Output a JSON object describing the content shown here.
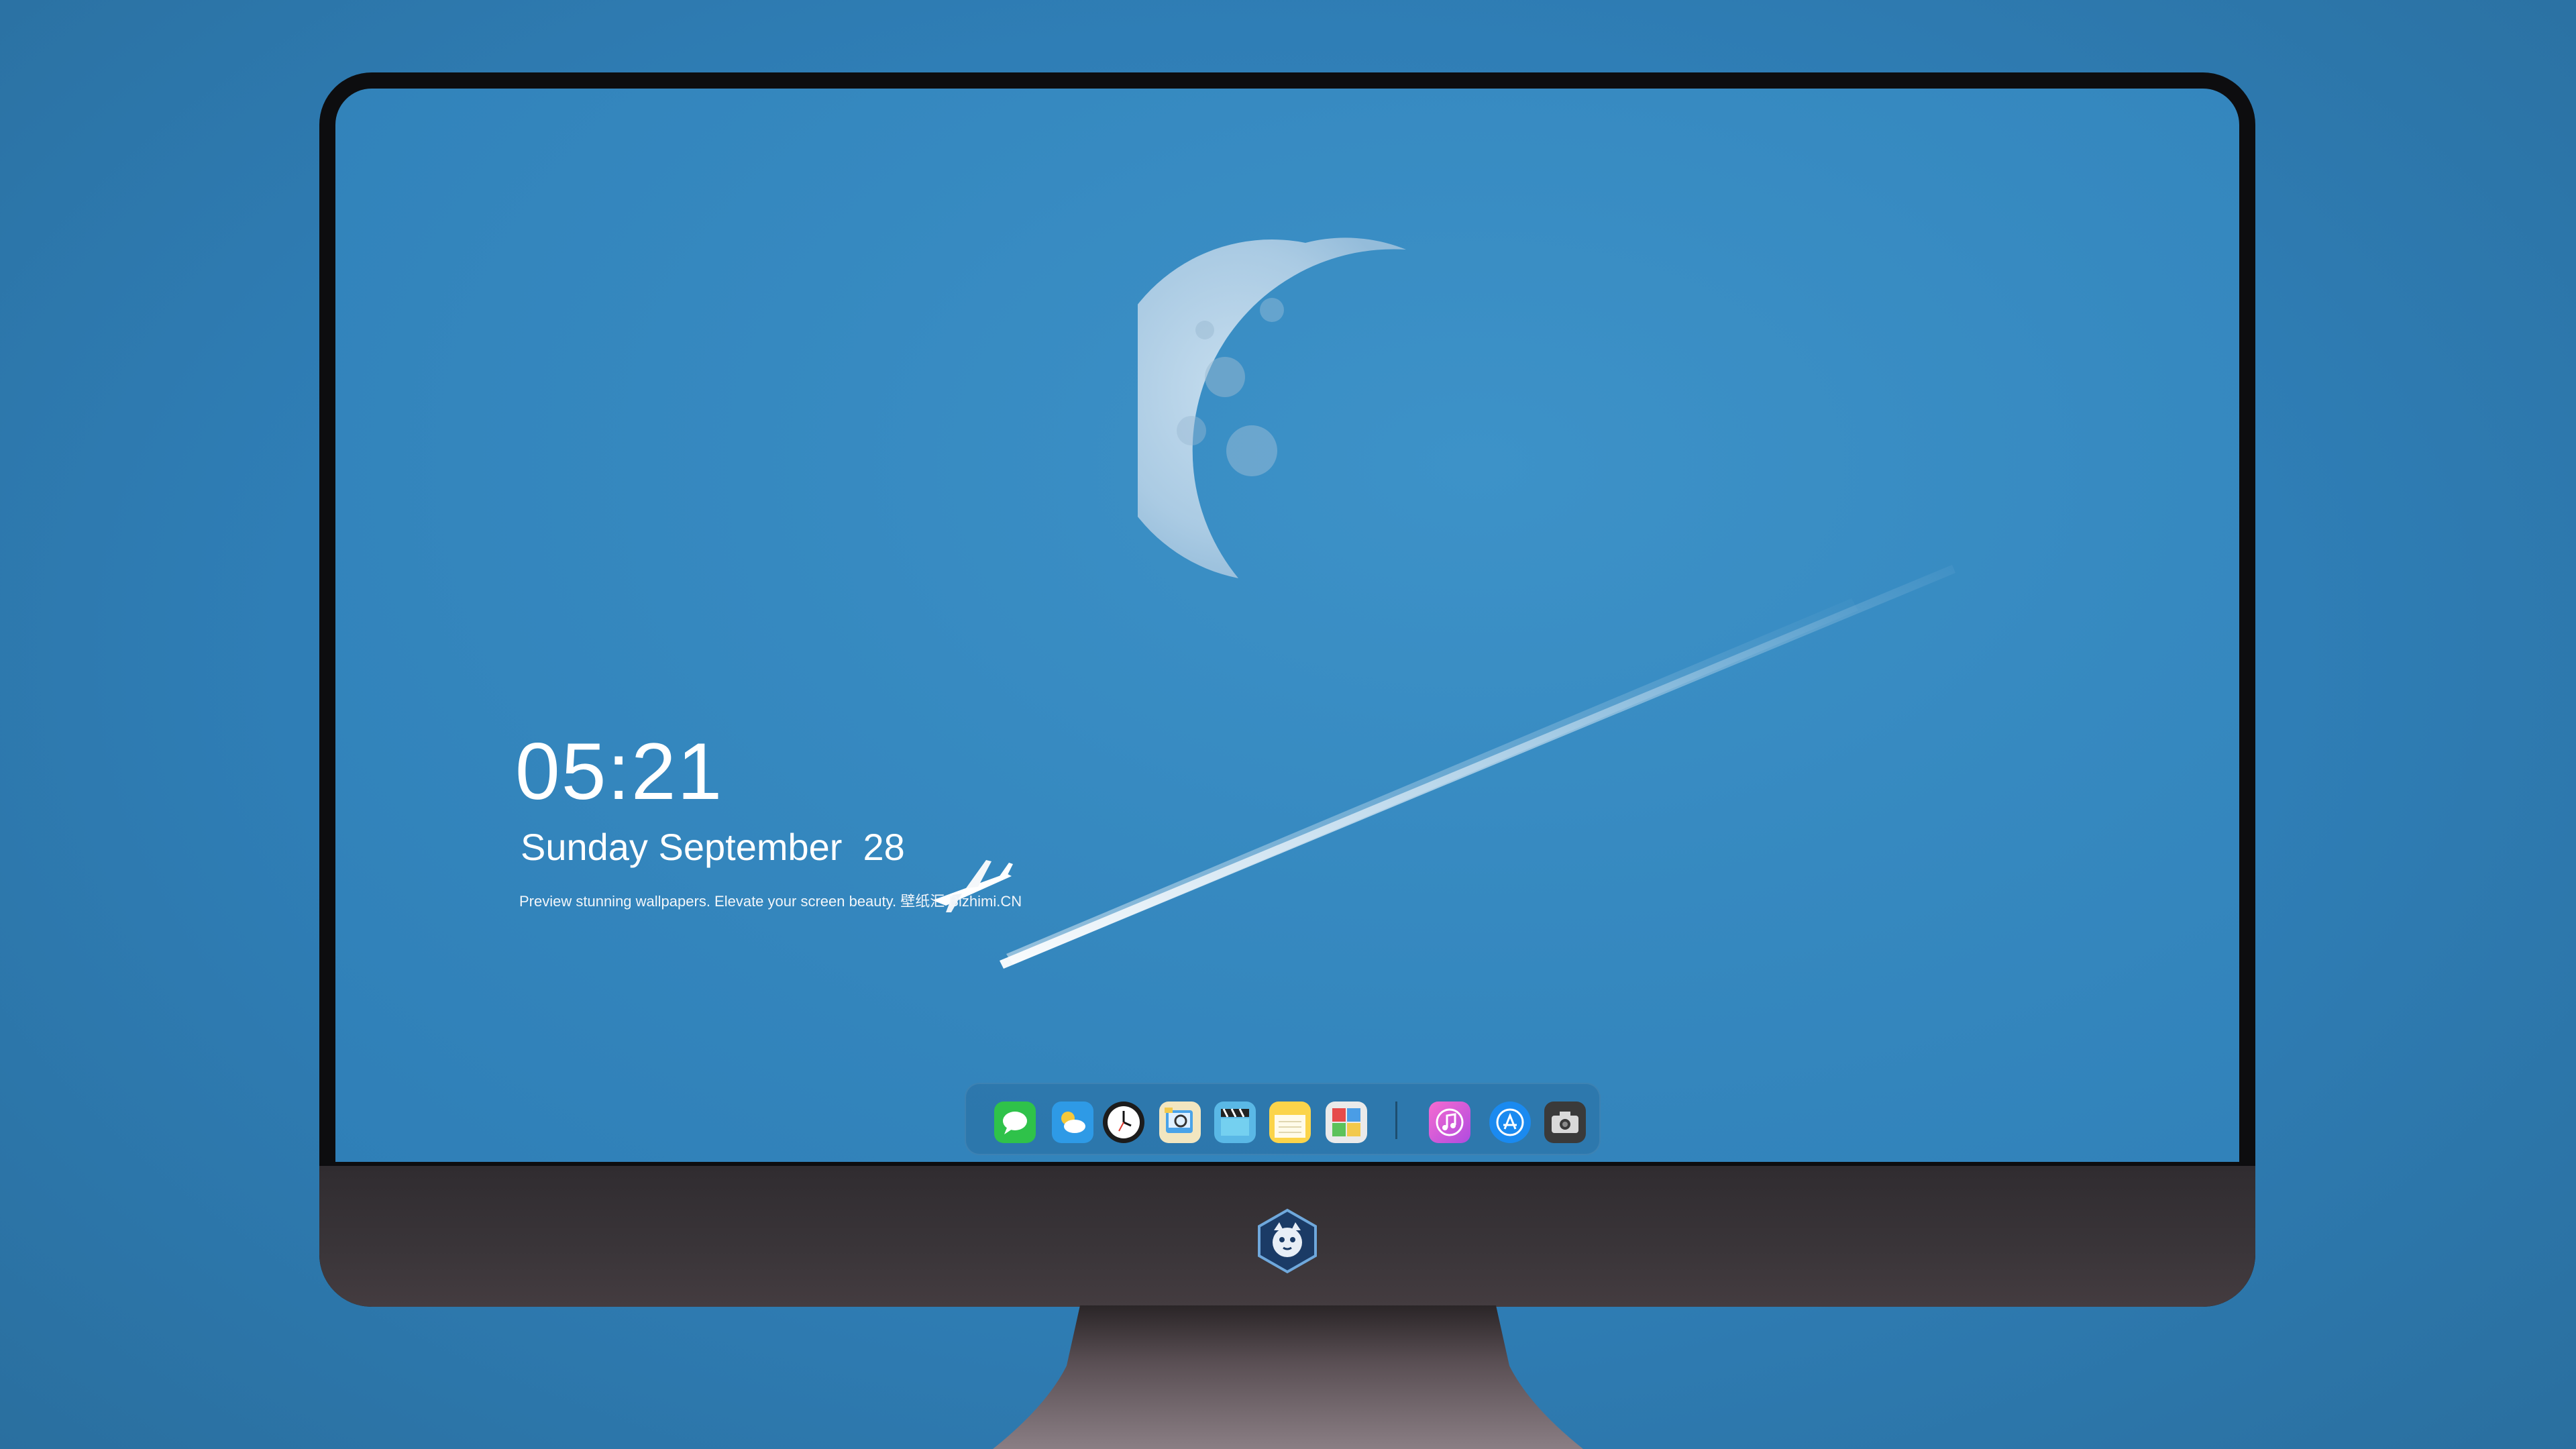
{
  "lock_screen": {
    "time": "05:21",
    "date": "Sunday September  28",
    "caption": "Preview stunning wallpapers. Elevate your screen beauty. 壁纸汇 Bizhimi.CN"
  },
  "dock": {
    "apps": [
      {
        "name": "messages-icon",
        "color": "#2fc24a"
      },
      {
        "name": "weather-icon",
        "color": "#2e9ae6"
      },
      {
        "name": "clock-icon",
        "color": "#1c1c1c"
      },
      {
        "name": "preview-icon",
        "color": "#f2c94c"
      },
      {
        "name": "clips-icon",
        "color": "#5ab8e6"
      },
      {
        "name": "notes-icon",
        "color": "#fbd44a"
      },
      {
        "name": "photo-booth-icon",
        "color": "#6fb96a"
      },
      {
        "name": "music-icon",
        "color": "#e04fd8"
      },
      {
        "name": "app-store-icon",
        "color": "#1a8af0"
      },
      {
        "name": "camera-icon",
        "color": "#3a3a3a"
      }
    ]
  },
  "colors": {
    "desktop_bg": "#2f7eb6",
    "screen_sky": "#3689c0",
    "monitor_bezel": "#0d0d0f",
    "chin": "#3a3539"
  }
}
